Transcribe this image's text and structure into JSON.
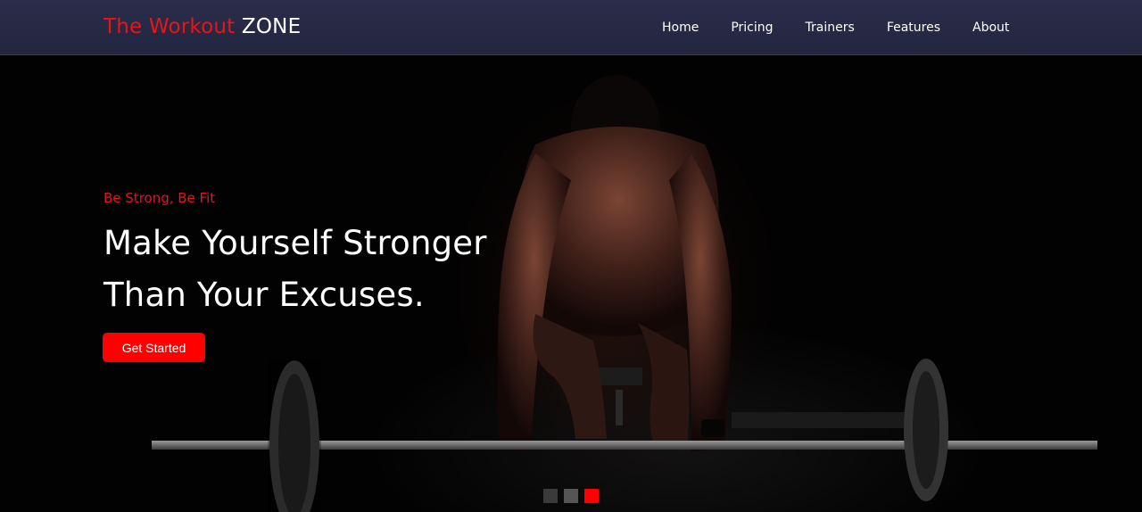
{
  "brand": {
    "part1": "The Workout",
    "part2": "ZONE"
  },
  "nav": {
    "items": [
      {
        "label": "Home"
      },
      {
        "label": "Pricing"
      },
      {
        "label": "Trainers"
      },
      {
        "label": "Features"
      },
      {
        "label": "About"
      }
    ]
  },
  "hero": {
    "tagline": "Be Strong, Be Fit",
    "headline_line1": "Make Yourself Stronger",
    "headline_line2": "Than Your Excuses.",
    "cta_label": "Get Started",
    "carousel": {
      "slides": 3,
      "active_index": 2
    }
  },
  "colors": {
    "accent": "#ff0000",
    "brand_red": "#e8141a",
    "navbar": "#262940",
    "background": "#000000"
  }
}
